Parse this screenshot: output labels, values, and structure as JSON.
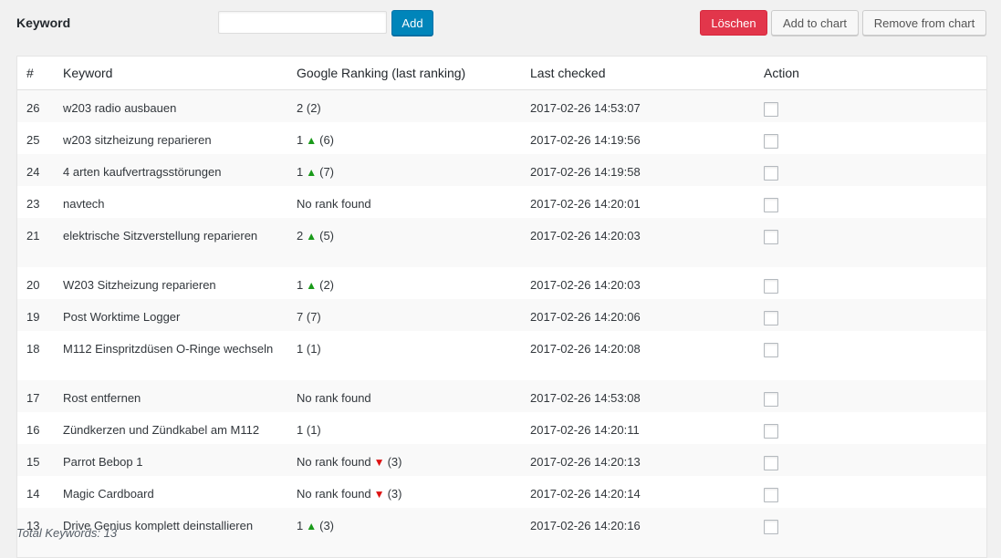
{
  "toolbar": {
    "keyword_label": "Keyword",
    "keyword_input_value": "",
    "add_label": "Add",
    "delete_label": "Löschen",
    "add_to_chart_label": "Add to chart",
    "remove_from_chart_label": "Remove from chart"
  },
  "table": {
    "headers": {
      "num": "#",
      "keyword": "Keyword",
      "ranking": "Google Ranking (last ranking)",
      "checked": "Last checked",
      "action": "Action"
    },
    "rows": [
      {
        "num": "26",
        "keyword": "w203 radio ausbauen",
        "rank": "2",
        "trend": "",
        "last": "(2)",
        "checked": "2017-02-26 14:53:07"
      },
      {
        "num": "25",
        "keyword": "w203 sitzheizung reparieren",
        "rank": "1",
        "trend": "up",
        "last": "(6)",
        "checked": "2017-02-26 14:19:56"
      },
      {
        "num": "24",
        "keyword": "4 arten kaufvertragsstörungen",
        "rank": "1",
        "trend": "up",
        "last": "(7)",
        "checked": "2017-02-26 14:19:58"
      },
      {
        "num": "23",
        "keyword": "navtech",
        "rank": "No rank found",
        "trend": "",
        "last": "",
        "checked": "2017-02-26 14:20:01"
      },
      {
        "num": "21",
        "keyword": "elektrische Sitzverstellung reparieren",
        "rank": "2",
        "trend": "up",
        "last": "(5)",
        "checked": "2017-02-26 14:20:03"
      },
      {
        "num": "20",
        "keyword": "W203 Sitzheizung reparieren",
        "rank": "1",
        "trend": "up",
        "last": "(2)",
        "checked": "2017-02-26 14:20:03"
      },
      {
        "num": "19",
        "keyword": "Post Worktime Logger",
        "rank": "7",
        "trend": "",
        "last": "(7)",
        "checked": "2017-02-26 14:20:06"
      },
      {
        "num": "18",
        "keyword": "M112 Einspritzdüsen O-Ringe wechseln",
        "rank": "1",
        "trend": "",
        "last": "(1)",
        "checked": "2017-02-26 14:20:08"
      },
      {
        "num": "17",
        "keyword": "Rost entfernen",
        "rank": "No rank found",
        "trend": "",
        "last": "",
        "checked": "2017-02-26 14:53:08"
      },
      {
        "num": "16",
        "keyword": "Zündkerzen und Zündkabel am M112",
        "rank": "1",
        "trend": "",
        "last": "(1)",
        "checked": "2017-02-26 14:20:11"
      },
      {
        "num": "15",
        "keyword": "Parrot Bebop 1",
        "rank": "No rank found",
        "trend": "down",
        "last": "(3)",
        "checked": "2017-02-26 14:20:13"
      },
      {
        "num": "14",
        "keyword": "Magic Cardboard",
        "rank": "No rank found",
        "trend": "down",
        "last": "(3)",
        "checked": "2017-02-26 14:20:14"
      },
      {
        "num": "13",
        "keyword": "Drive Genius komplett deinstallieren",
        "rank": "1",
        "trend": "up",
        "last": "(3)",
        "checked": "2017-02-26 14:20:16"
      }
    ]
  },
  "footer": {
    "total_label": "Total Keywords: 13"
  },
  "icons": {
    "up": "triangle-up-icon",
    "down": "triangle-down-icon"
  },
  "colors": {
    "primary": "#0085ba",
    "danger": "#e2364b",
    "trend_up": "#1a9a1a",
    "trend_down": "#dd1111"
  }
}
